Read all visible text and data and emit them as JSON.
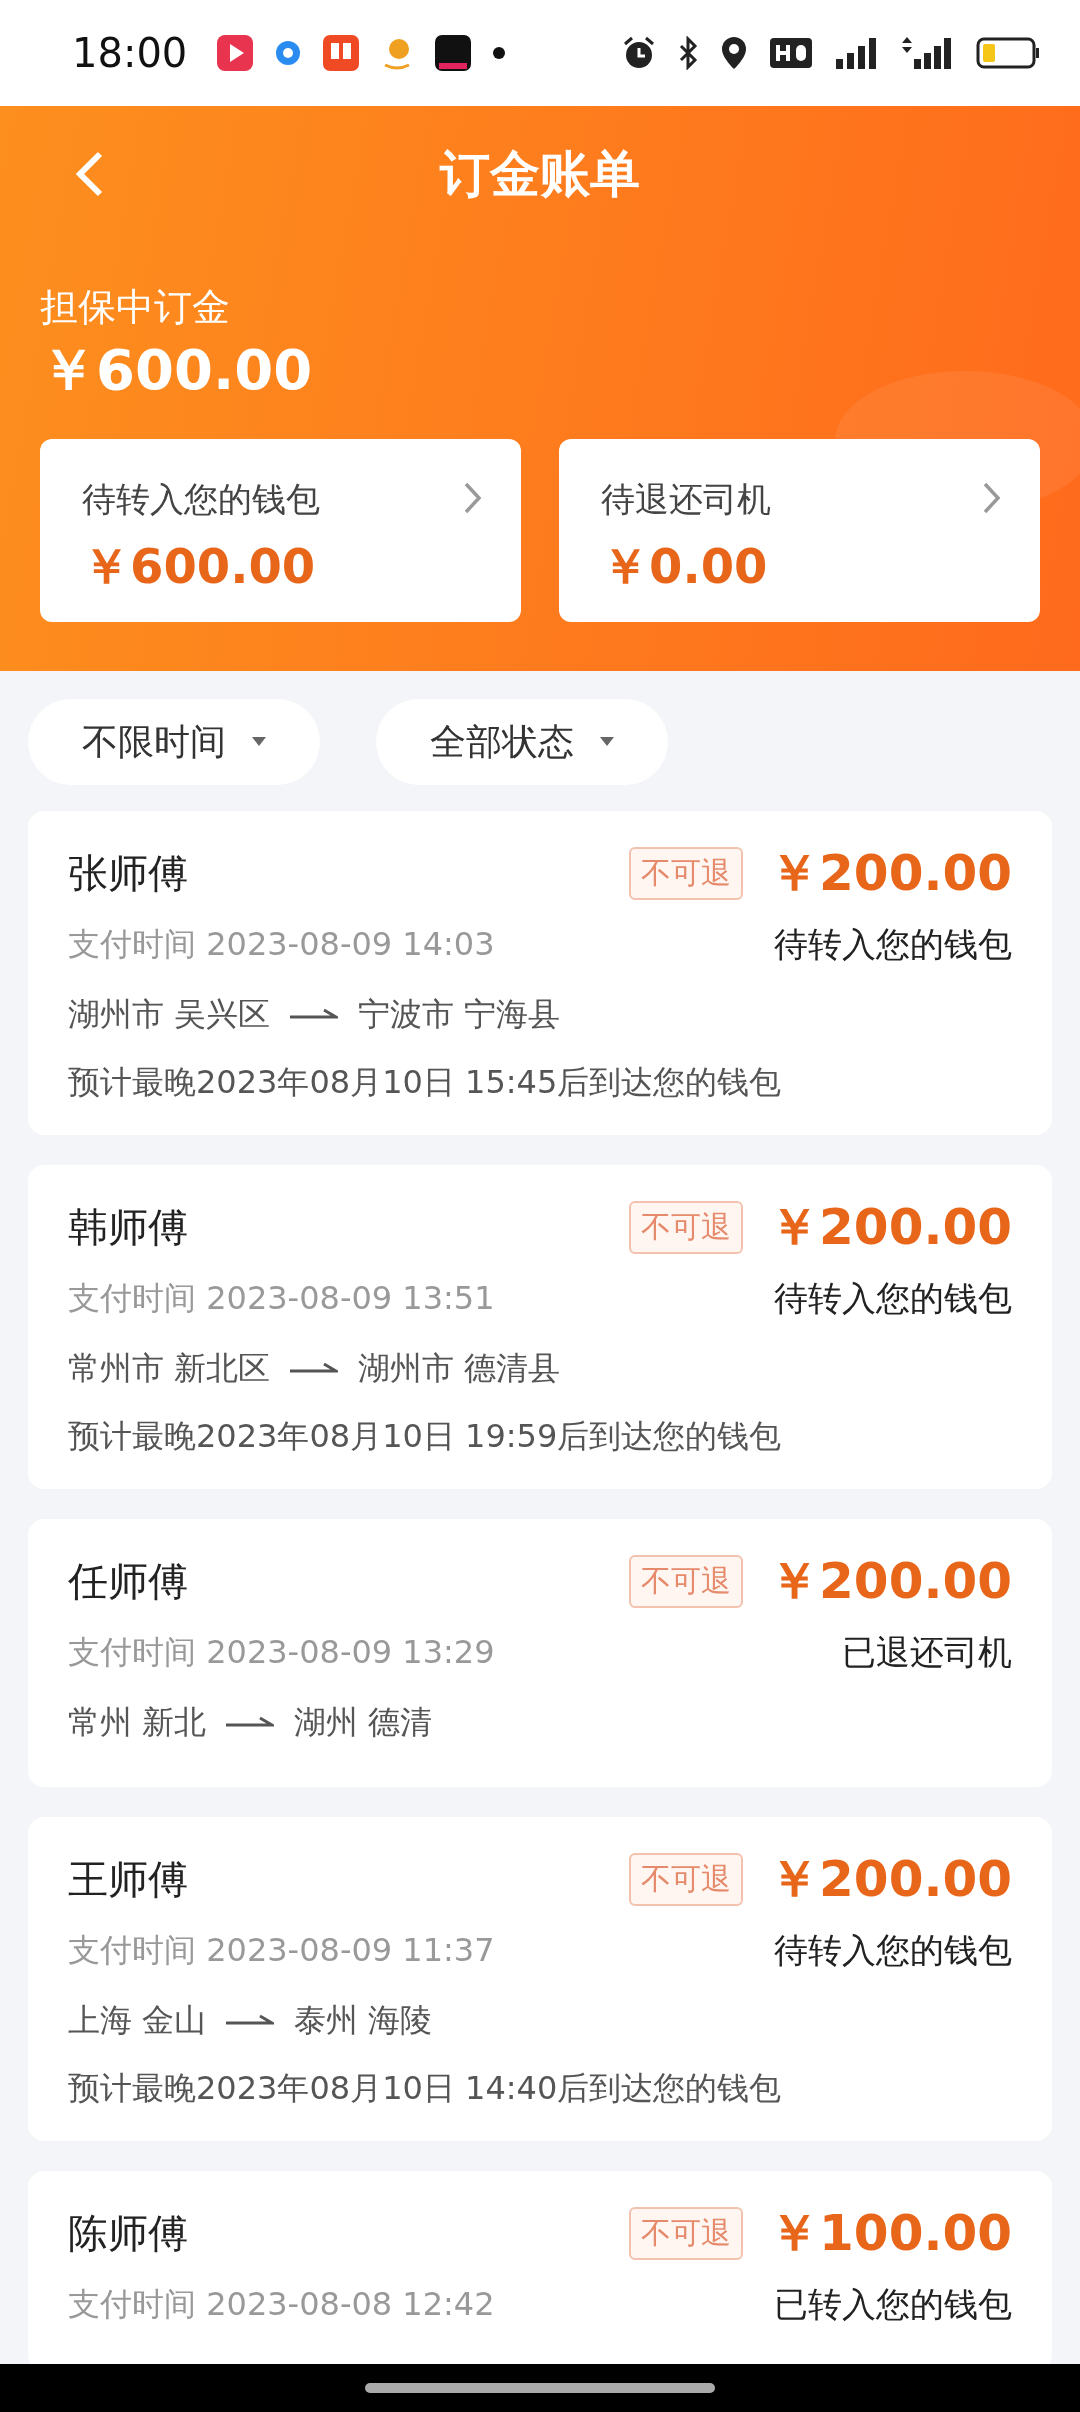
{
  "status_bar": {
    "time": "18:00"
  },
  "header": {
    "title": "订金账单",
    "summary_label": "担保中订金",
    "summary_amount": "￥600.00"
  },
  "summary_cards": [
    {
      "label": "待转入您的钱包",
      "amount": "￥600.00"
    },
    {
      "label": "待退还司机",
      "amount": "￥0.00"
    }
  ],
  "filters": [
    {
      "label": "不限时间"
    },
    {
      "label": "全部状态"
    }
  ],
  "orders": [
    {
      "driver": "张师傅",
      "tag": "不可退",
      "amount": "￥200.00",
      "pay_time": "支付时间 2023-08-09 14:03",
      "status": "待转入您的钱包",
      "route": {
        "from": "湖州市 吴兴区",
        "to": "宁波市 宁海县"
      },
      "note": "预计最晚2023年08月10日 15:45后到达您的钱包"
    },
    {
      "driver": "韩师傅",
      "tag": "不可退",
      "amount": "￥200.00",
      "pay_time": "支付时间 2023-08-09 13:51",
      "status": "待转入您的钱包",
      "route": {
        "from": "常州市 新北区",
        "to": "湖州市 德清县"
      },
      "note": "预计最晚2023年08月10日 19:59后到达您的钱包"
    },
    {
      "driver": "任师傅",
      "tag": "不可退",
      "amount": "￥200.00",
      "pay_time": "支付时间 2023-08-09 13:29",
      "status": "已退还司机",
      "route": {
        "from": "常州 新北",
        "to": "湖州 德清"
      }
    },
    {
      "driver": "王师傅",
      "tag": "不可退",
      "amount": "￥200.00",
      "pay_time": "支付时间 2023-08-09 11:37",
      "status": "待转入您的钱包",
      "route": {
        "from": "上海 金山",
        "to": "泰州 海陵"
      },
      "note": "预计最晚2023年08月10日 14:40后到达您的钱包"
    },
    {
      "driver": "陈师傅",
      "tag": "不可退",
      "amount": "￥100.00",
      "pay_time": "支付时间 2023-08-08 12:42",
      "status": "已转入您的钱包"
    }
  ]
}
